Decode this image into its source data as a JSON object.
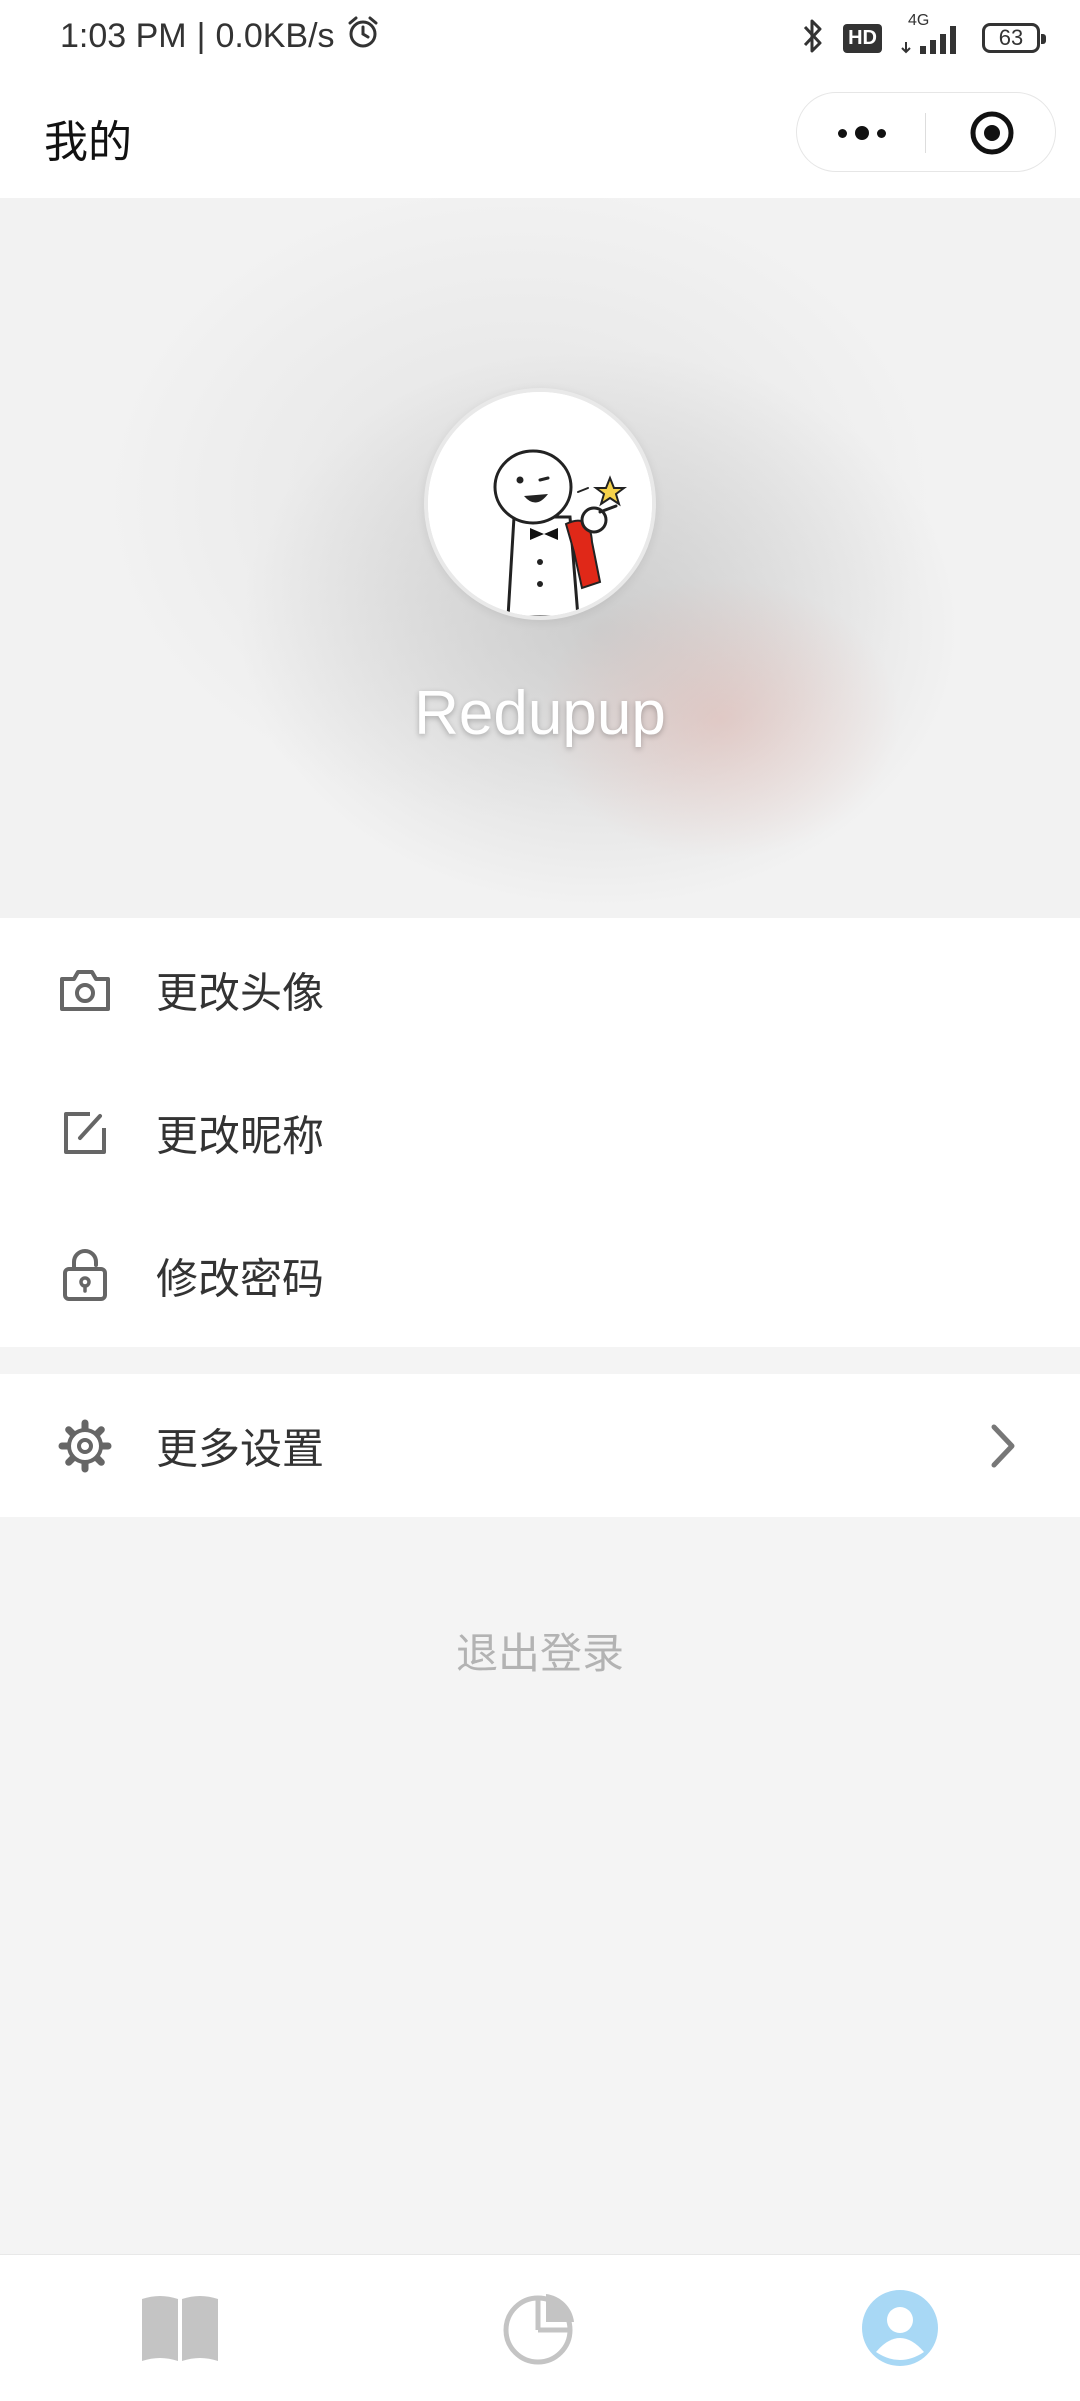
{
  "status_bar": {
    "time": "1:03 PM",
    "separator": "|",
    "speed": "0.0KB/s",
    "hd_label": "HD",
    "network_label": "4G",
    "battery": "63",
    "icons": [
      "alarm-icon",
      "bluetooth-icon",
      "hd-icon",
      "signal-icon",
      "battery-icon"
    ]
  },
  "nav": {
    "title": "我的",
    "icons": [
      "more-dots-icon",
      "close-target-icon"
    ]
  },
  "profile": {
    "username": "Redupup",
    "avatar": "cartoon-avatar"
  },
  "menu": {
    "items": [
      {
        "label": "更改头像",
        "icon": "camera-icon"
      },
      {
        "label": "更改昵称",
        "icon": "edit-icon"
      },
      {
        "label": "修改密码",
        "icon": "lock-icon"
      }
    ],
    "more": {
      "label": "更多设置",
      "icon": "gear-icon"
    }
  },
  "logout_label": "退出登录",
  "tabs": [
    {
      "icon": "book-icon",
      "active": false
    },
    {
      "icon": "pie-chart-icon",
      "active": false
    },
    {
      "icon": "user-icon",
      "active": true
    }
  ],
  "colors": {
    "accent": "#a8d8f5",
    "tab_inactive": "#c4c4c4",
    "logout_text": "#b3b3b3"
  }
}
